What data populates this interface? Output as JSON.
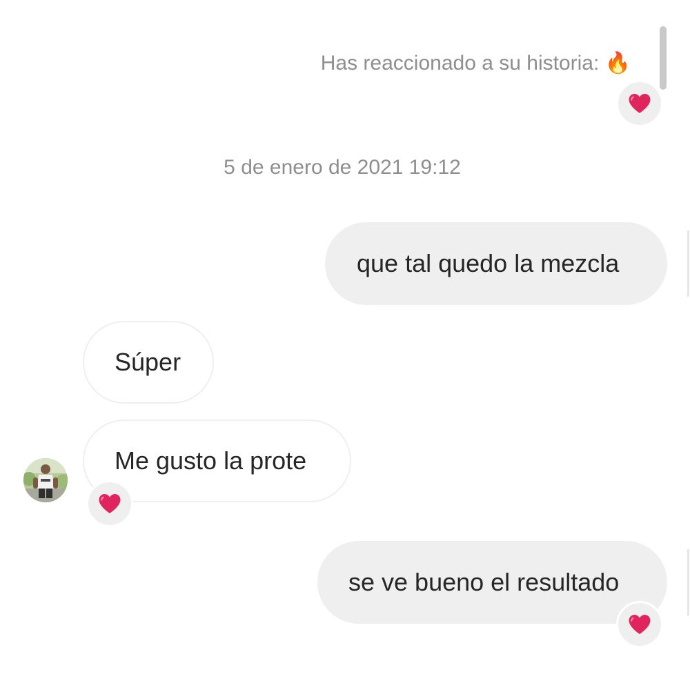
{
  "chat": {
    "story_reply": {
      "text": "Has reaccionado a su historia: 🔥",
      "reaction": "heart-icon"
    },
    "timestamp": "5 de enero de 2021 19:12",
    "messages": [
      {
        "direction": "sent",
        "text": "que tal quedo la mezcla"
      },
      {
        "direction": "received",
        "text": "Súper"
      },
      {
        "direction": "received",
        "text": "Me gusto la prote",
        "reaction": "heart-icon"
      },
      {
        "direction": "sent",
        "text": "se ve bueno el resultado",
        "reaction": "heart-icon"
      }
    ]
  },
  "colors": {
    "sent_bubble": "#efefef",
    "received_border": "#efefef",
    "meta_text": "#8e8e8e",
    "message_text": "#262626",
    "heart": "#e0245e"
  }
}
